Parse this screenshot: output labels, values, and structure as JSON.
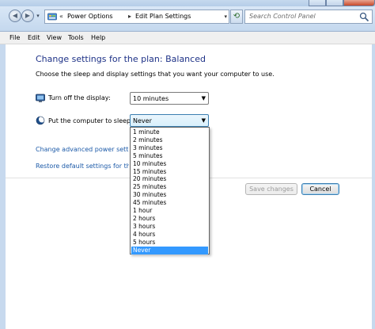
{
  "address_bar": {
    "crumbs": [
      "Power Options",
      "Edit Plan Settings"
    ]
  },
  "search": {
    "placeholder": "Search Control Panel"
  },
  "menu": [
    "File",
    "Edit",
    "View",
    "Tools",
    "Help"
  ],
  "main": {
    "title": "Change settings for the plan: Balanced",
    "subtitle": "Choose the sleep and display settings that you want your computer to use.",
    "display": {
      "label": "Turn off the display:",
      "value": "10 minutes"
    },
    "sleep": {
      "label": "Put the computer to sleep:",
      "value": "Never",
      "options": [
        "1 minute",
        "2 minutes",
        "3 minutes",
        "5 minutes",
        "10 minutes",
        "15 minutes",
        "20 minutes",
        "25 minutes",
        "30 minutes",
        "45 minutes",
        "1 hour",
        "2 hours",
        "3 hours",
        "4 hours",
        "5 hours",
        "Never"
      ],
      "selected_option": "Never"
    },
    "links": {
      "advanced": "Change advanced power settings",
      "restore": "Restore default settings for this plan"
    }
  },
  "buttons": {
    "save": "Save changes",
    "cancel": "Cancel"
  }
}
